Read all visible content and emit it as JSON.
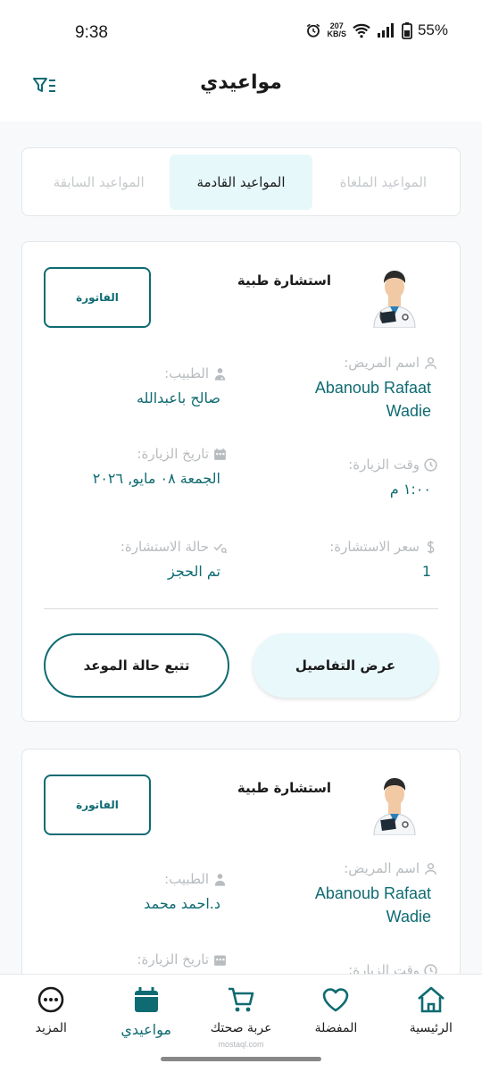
{
  "status_bar": {
    "time": "9:38",
    "speed_value": "207",
    "speed_unit": "KB/S",
    "battery": "55%"
  },
  "header": {
    "title": "مواعيدي",
    "filter_icon": "filter-list-icon"
  },
  "tabs": [
    {
      "label": "المواعيد الملغاة",
      "active": false
    },
    {
      "label": "المواعيد القادمة",
      "active": true
    },
    {
      "label": "المواعيد السابقة",
      "active": false
    }
  ],
  "appointments": [
    {
      "title": "استشارة طبية",
      "invoice_label": "الفاتورة",
      "patient_label": "اسم المريض:",
      "patient_name": "Abanoub Rafaat Wadie",
      "doctor_label": "الطبيب:",
      "doctor_name": "صالح باعبدالله",
      "visit_time_label": "وقت الزيارة:",
      "visit_time": "١:٠٠ م",
      "visit_date_label": "تاريخ الزيارة:",
      "visit_date": "الجمعة ٠٨ مايو, ٢٠٢٦",
      "price_label": "سعر الاستشارة:",
      "price": "1",
      "status_label": "حالة الاستشارة:",
      "status": "تم الحجز",
      "details_button": "عرض التفاصيل",
      "track_button": "تتبع حالة الموعد"
    },
    {
      "title": "استشارة طبية",
      "invoice_label": "الفاتورة",
      "patient_label": "اسم المريض:",
      "patient_name": "Abanoub Rafaat Wadie",
      "doctor_label": "الطبيب:",
      "doctor_name": "د.احمد محمد",
      "visit_time_label": "وقت الزيارة:",
      "visit_date_label": "تاريخ الزيارة:"
    }
  ],
  "bottom_nav": [
    {
      "label": "الرئيسية",
      "icon": "home-icon",
      "active": false
    },
    {
      "label": "المفضلة",
      "icon": "heart-icon",
      "active": false
    },
    {
      "label": "عربة صحتك",
      "icon": "cart-icon",
      "active": false
    },
    {
      "label": "مواعيدي",
      "icon": "calendar-icon",
      "active": true
    },
    {
      "label": "المزيد",
      "icon": "more-icon",
      "active": false
    }
  ],
  "watermark": "mostaql.com",
  "colors": {
    "primary": "#0f6b72",
    "active_tab_bg": "#e6f8fa",
    "label_gray": "#b8bcbf"
  }
}
